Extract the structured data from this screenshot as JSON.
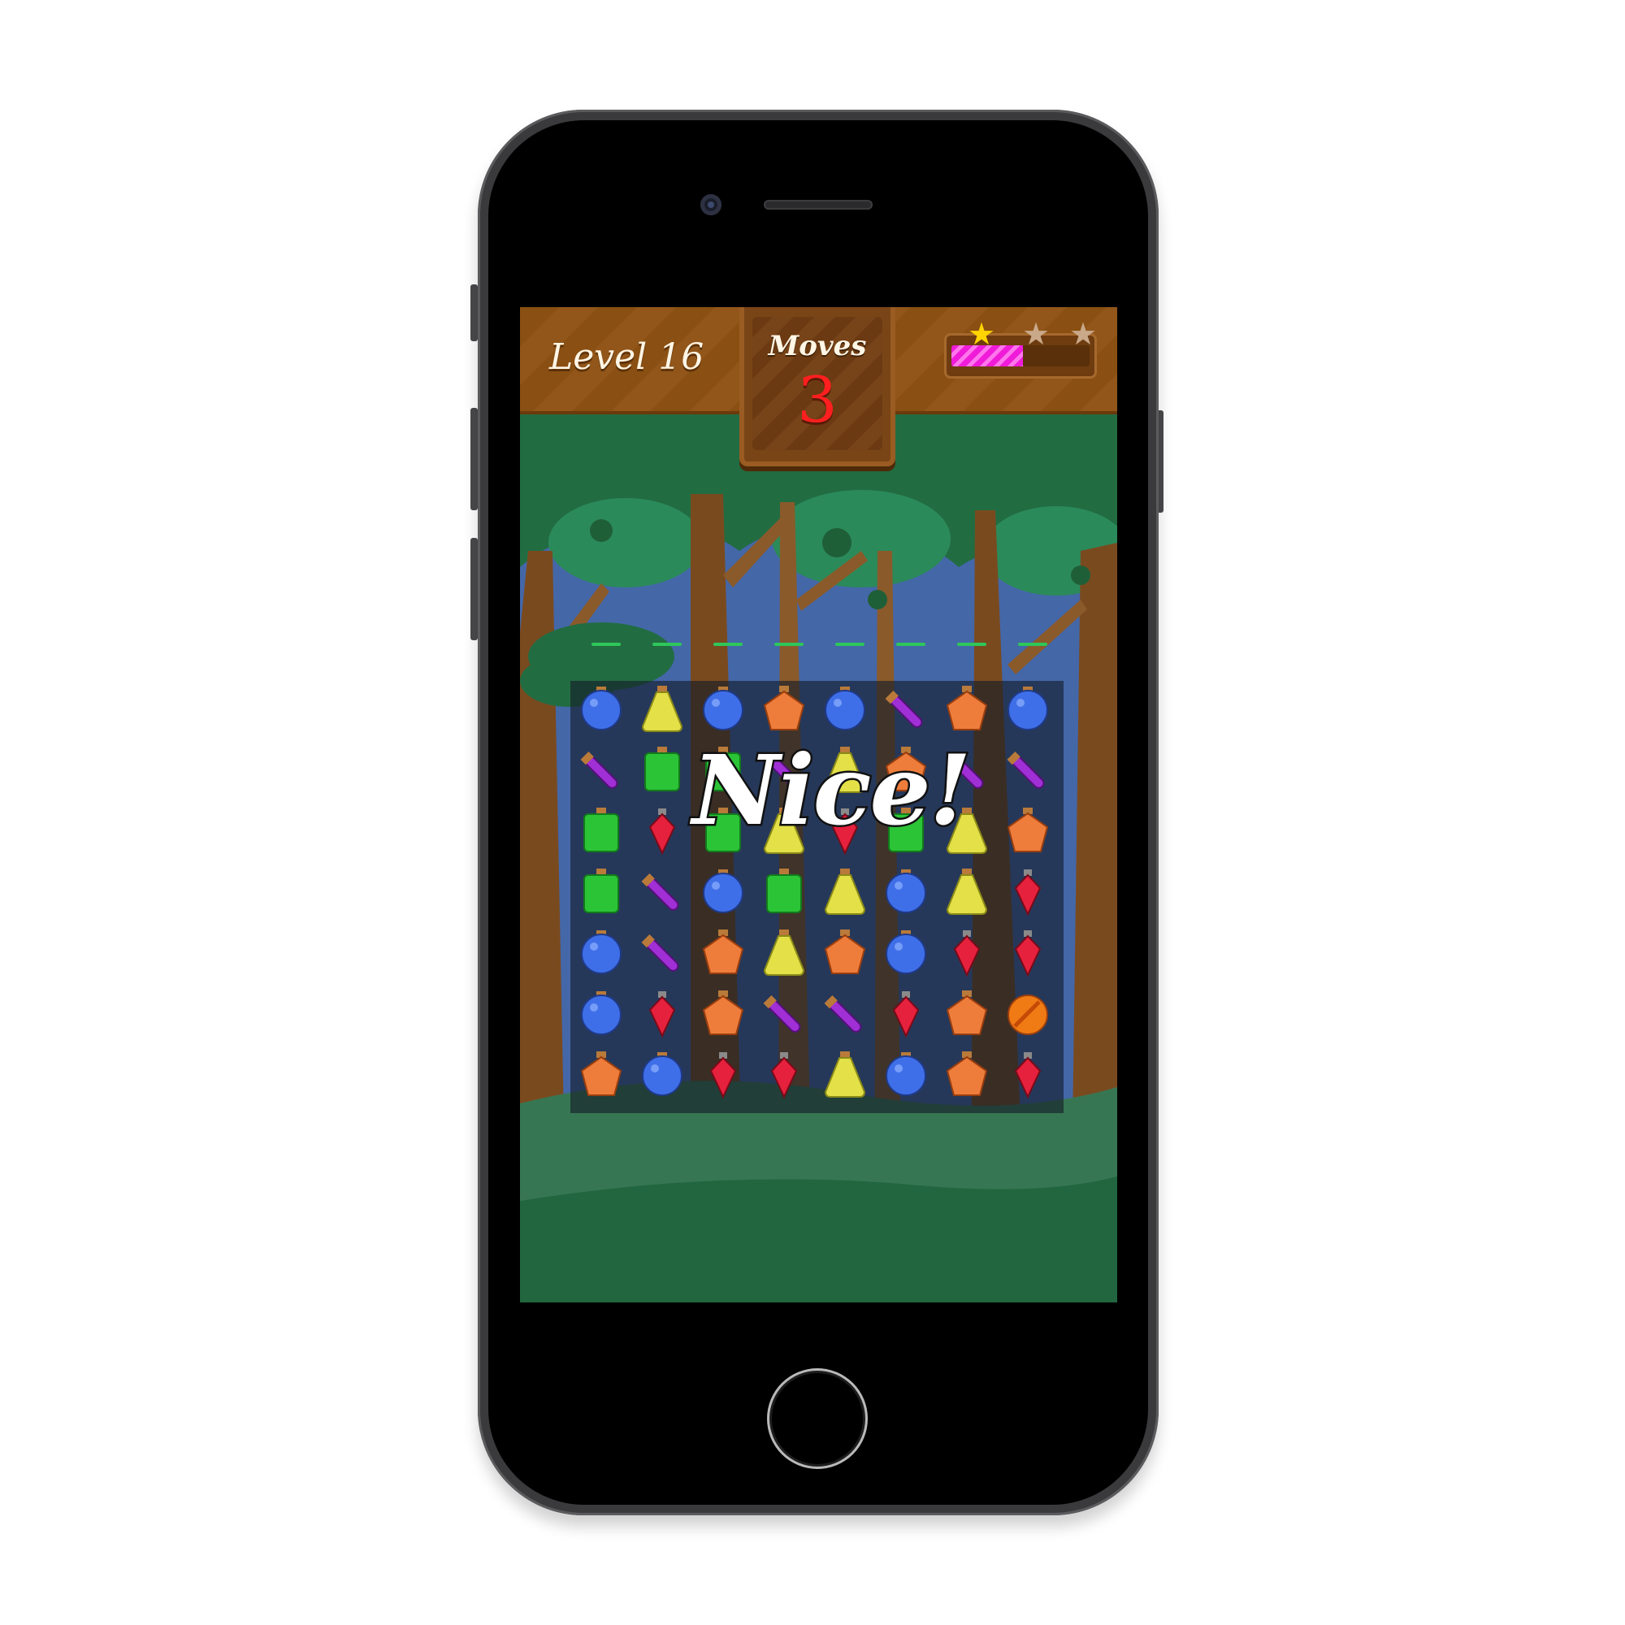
{
  "game": {
    "level_label": "Level 16",
    "moves_label": "Moves",
    "moves_value": "3",
    "score_progress": 0.52,
    "stars": [
      {
        "icon": "star-icon",
        "earned": true,
        "color": "#ffd400"
      },
      {
        "icon": "star-icon",
        "earned": false,
        "color": "#c9a98a"
      },
      {
        "icon": "star-icon",
        "earned": false,
        "color": "#c9a98a"
      }
    ],
    "feedback_text": "Nice!"
  },
  "colors": {
    "blue_potion": "#3f6fe8",
    "yellow_potion": "#e3e048",
    "orange_potion": "#ee7d3c",
    "purple_vial": "#a02fd6",
    "green_potion": "#2cc437",
    "red_crystal": "#e6213d",
    "accent_progress": "#f01bd8",
    "moves_number": "#ff1f1f"
  },
  "board": {
    "rows": 7,
    "cols": 8,
    "tiles": [
      [
        "blue",
        "yellow",
        "blue",
        "orange",
        "blue",
        "purple",
        "orange",
        "blue"
      ],
      [
        "purple",
        "green",
        "green",
        "purple",
        "yellow",
        "orange",
        "purple",
        "purple"
      ],
      [
        "green",
        "red",
        "green",
        "yellow",
        "red",
        "green",
        "yellow",
        "orange"
      ],
      [
        "green",
        "purple",
        "blue",
        "green",
        "yellow",
        "blue",
        "yellow",
        "red"
      ],
      [
        "blue",
        "purple",
        "orange",
        "yellow",
        "orange",
        "blue",
        "red",
        "red"
      ],
      [
        "blue",
        "red",
        "orange",
        "purple",
        "purple",
        "red",
        "orange",
        "ball"
      ],
      [
        "orange",
        "blue",
        "red",
        "red",
        "yellow",
        "blue",
        "orange",
        "red"
      ]
    ]
  }
}
